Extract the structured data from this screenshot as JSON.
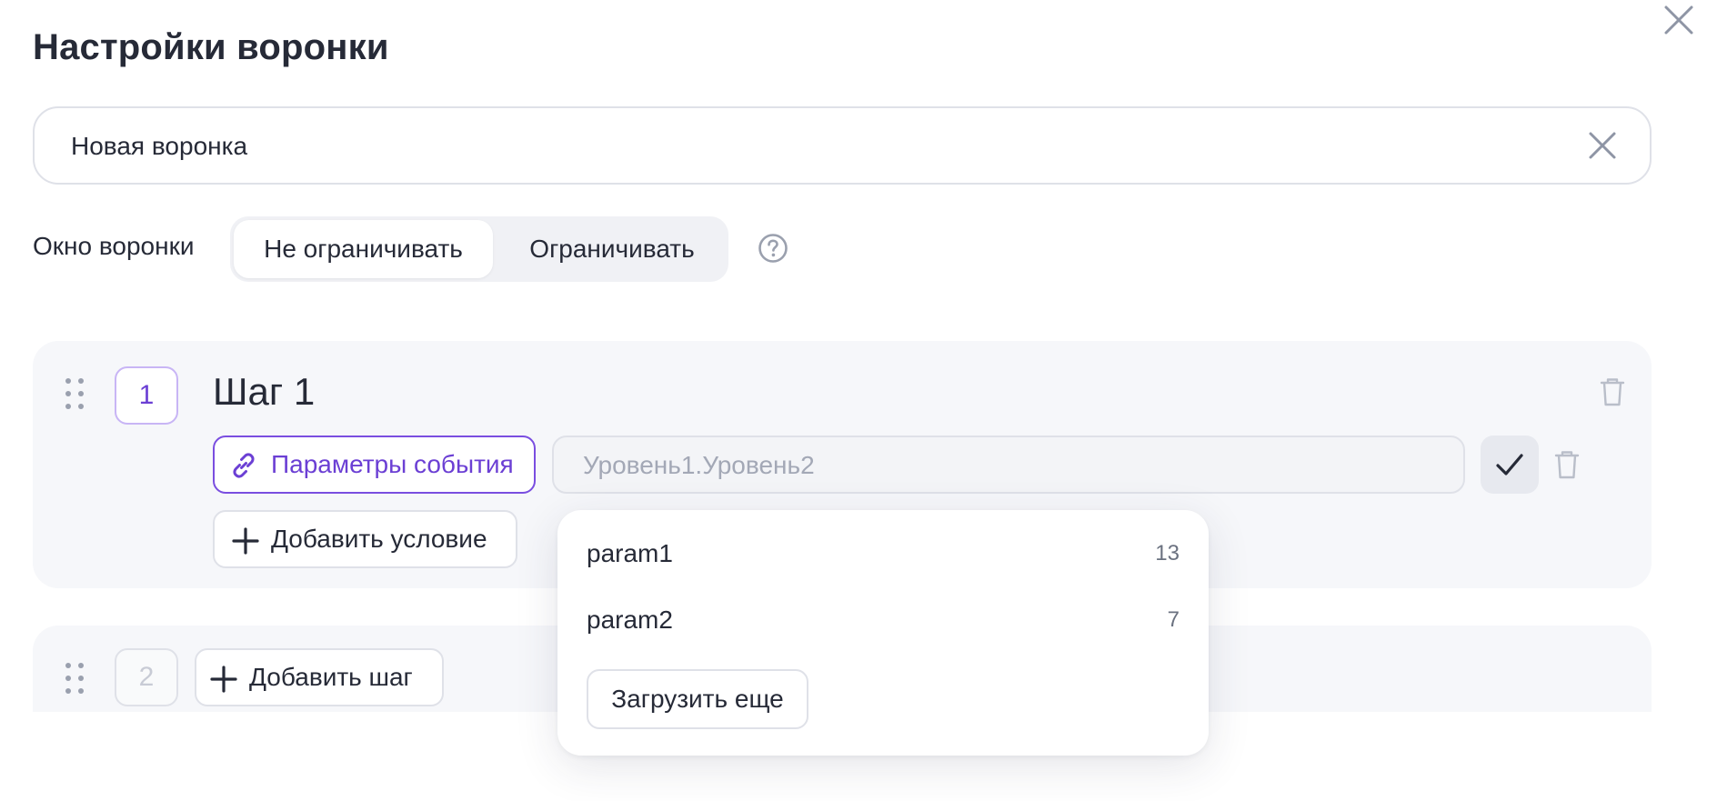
{
  "modal": {
    "title": "Настройки воронки"
  },
  "name_field": {
    "value": "Новая воронка"
  },
  "window": {
    "label": "Окно воронки",
    "options": [
      "Не ограничивать",
      "Ограничивать"
    ],
    "selected": "Не ограничивать"
  },
  "steps": [
    {
      "number": "1",
      "title": "Шаг 1",
      "condition": {
        "type_label": "Параметры события",
        "placeholder": "Уровень1.Уровень2"
      },
      "add_condition_label": "Добавить условие"
    }
  ],
  "new_step": {
    "number": "2",
    "add_label": "Добавить шаг"
  },
  "dropdown": {
    "items": [
      {
        "name": "param1",
        "count": "13"
      },
      {
        "name": "param2",
        "count": "7"
      }
    ],
    "load_more_label": "Загрузить еще"
  },
  "colors": {
    "accent": "#6b3fd4",
    "text": "#262a37",
    "card_bg": "#f6f7fa",
    "border": "#dfe1e8"
  },
  "icons": {
    "close": "close-icon",
    "clear": "clear-icon",
    "help": "question-circle-icon",
    "drag": "drag-handle-icon",
    "trash": "trash-icon",
    "link": "link-icon",
    "check": "check-icon",
    "plus": "plus-icon"
  }
}
